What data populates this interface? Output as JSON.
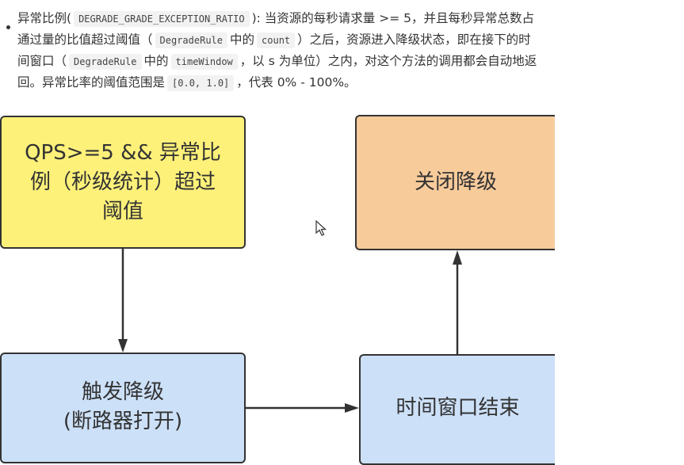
{
  "paragraph": {
    "line1": {
      "t1": "异常比例",
      "code1": "DEGRADE_GRADE_EXCEPTION_RATIO",
      "t2": "): 当资源的每秒请求量 >= 5，并且每秒异常总数占"
    },
    "line2": {
      "t1": "通过量的比值超过阈值（",
      "code1": "DegradeRule",
      "t2": "中的",
      "code2": "count",
      "t3": "）之后，资源进入降级状态，即在接下的时"
    },
    "line3": {
      "t1": "间窗口（",
      "code1": "DegradeRule",
      "t2": "中的",
      "code2": "timeWindow",
      "t3": "，以 s 为单位）之内，对这个方法的调用都会自动地返"
    },
    "line4": {
      "t1": "回。异常比率的阈值范围是",
      "code1": "[0.0, 1.0]",
      "t2": "，代表 0% - 100%。"
    }
  },
  "diagram": {
    "nodes": {
      "trigger_condition": [
        "QPS>=5 && 异常比",
        "例（秒级统计）超过",
        "阈值"
      ],
      "close_degrade": [
        "关闭降级"
      ],
      "trigger_degrade": [
        "触发降级",
        "(断路器打开)"
      ],
      "time_window_end": [
        "时间窗口结束"
      ]
    },
    "colors": {
      "condition": "#fdf17a",
      "close": "#f8cb9b",
      "state": "#cce0f8",
      "stroke": "#333333"
    },
    "edges": [
      {
        "from": "trigger_condition",
        "to": "trigger_degrade"
      },
      {
        "from": "trigger_degrade",
        "to": "time_window_end"
      },
      {
        "from": "time_window_end",
        "to": "close_degrade"
      }
    ]
  }
}
